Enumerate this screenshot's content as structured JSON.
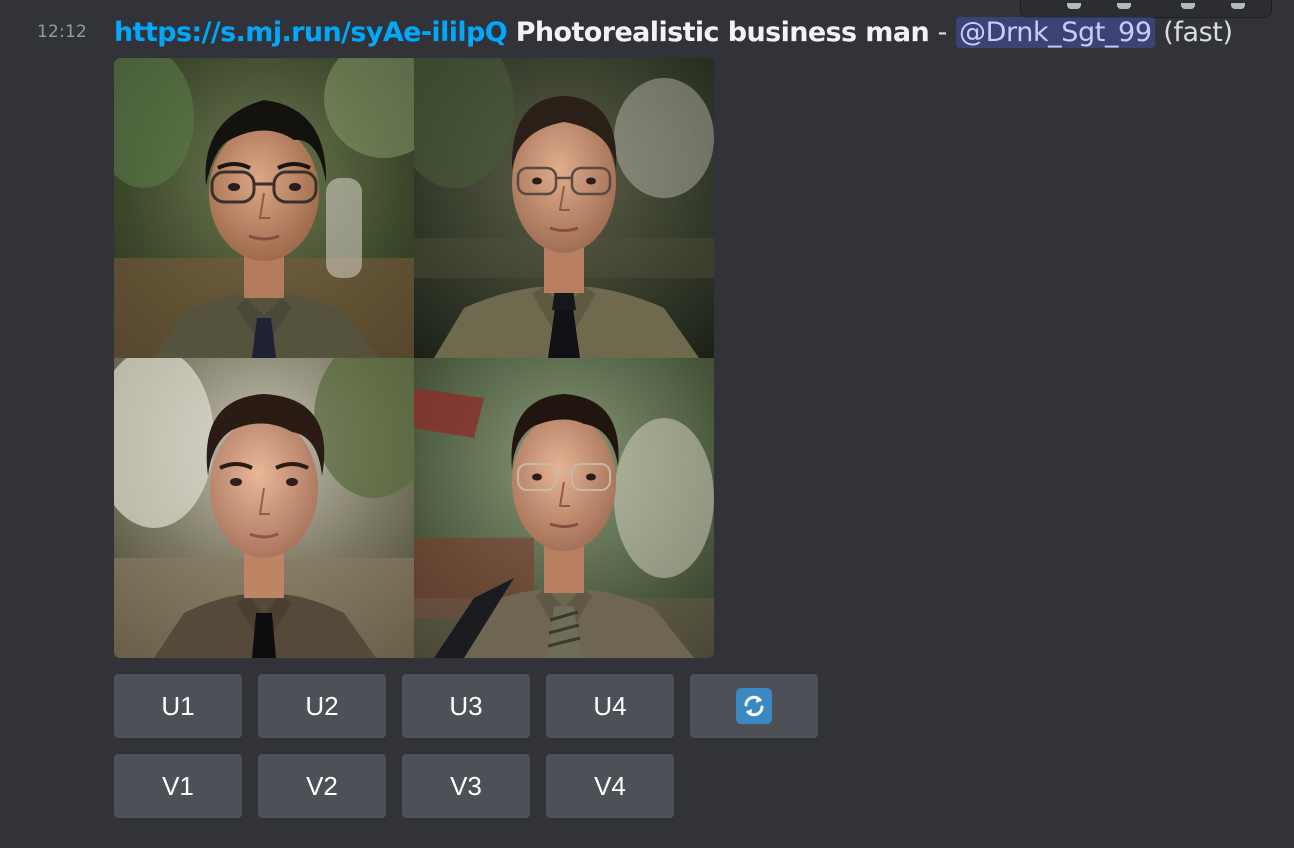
{
  "message": {
    "timestamp": "12:12",
    "link": "https://s.mj.run/syAe-ililpQ",
    "prompt": "Photorealistic business man",
    "separator": "-",
    "mention": "@Drnk_Sgt_99",
    "mode": "(fast)"
  },
  "images": [
    {
      "description": "man with swept black hair, dark-rim glasses, olive shirt, navy tie"
    },
    {
      "description": "man with short crew cut, wire glasses, olive shirt, black tie"
    },
    {
      "description": "man with swept dark hair, olive shirt, black tie"
    },
    {
      "description": "man with side-part hair, rimless glasses, olive shirt, striped tie, bag strap"
    }
  ],
  "buttons": {
    "upscale": [
      "U1",
      "U2",
      "U3",
      "U4"
    ],
    "variation": [
      "V1",
      "V2",
      "V3",
      "V4"
    ],
    "reroll_icon": "arrows-counterclockwise-icon"
  },
  "colors": {
    "background": "#313338",
    "link": "#00a8fc",
    "button": "#4e5058",
    "mention_bg": "#3c4270",
    "reroll_emoji": "#3b88c3"
  }
}
